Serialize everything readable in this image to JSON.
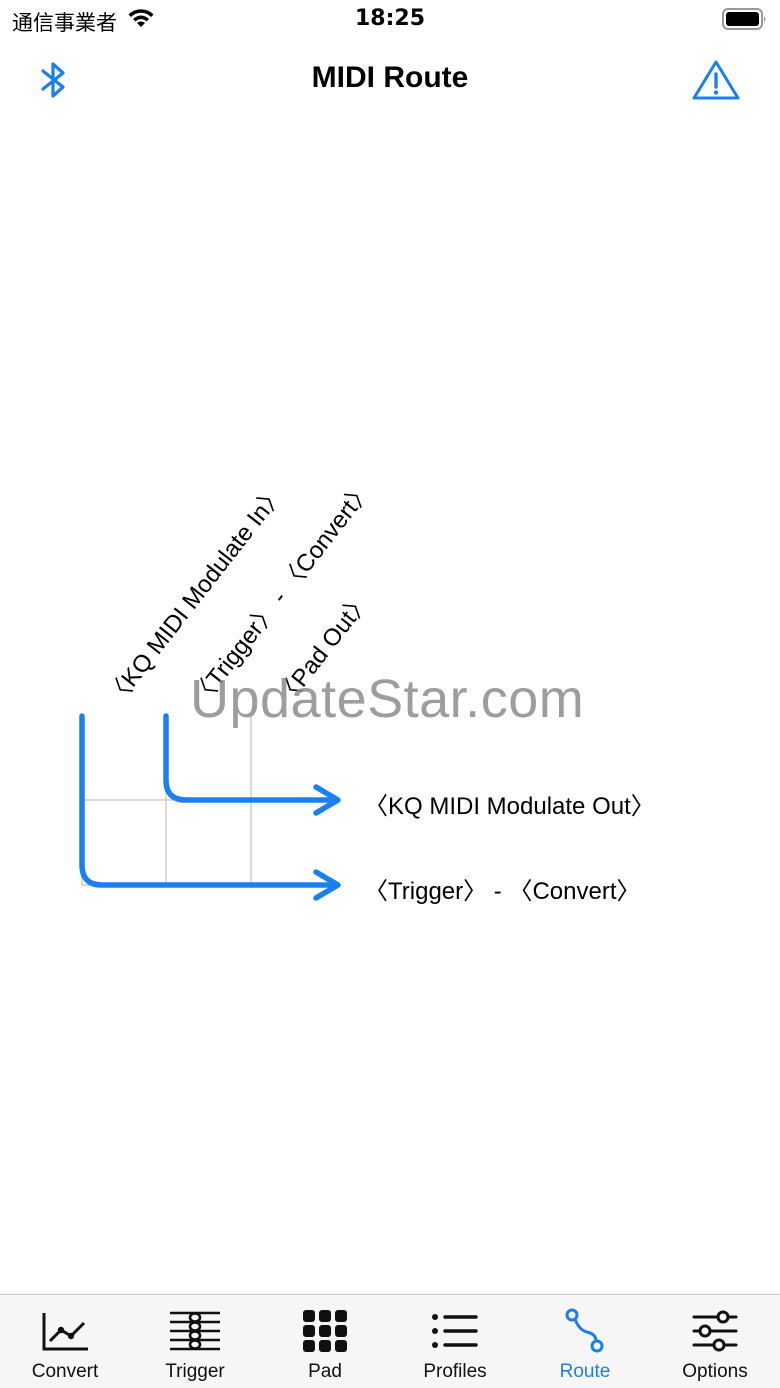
{
  "status_bar": {
    "carrier": "通信事業者",
    "time": "18:25"
  },
  "nav": {
    "title": "MIDI Route",
    "left_icon": "bluetooth-icon",
    "right_icon": "warning-icon"
  },
  "route": {
    "sources": [
      "〈KQ MIDI Modulate In〉",
      "〈Trigger〉 - 〈Convert〉",
      "〈Pad Out〉"
    ],
    "destinations": [
      "〈KQ MIDI Modulate Out〉",
      "〈Trigger〉 - 〈Convert〉"
    ]
  },
  "watermark": "UpdateStar.com",
  "tabs": [
    {
      "label": "Convert",
      "icon": "chart-line-icon"
    },
    {
      "label": "Trigger",
      "icon": "staff-notes-icon"
    },
    {
      "label": "Pad",
      "icon": "grid-pad-icon"
    },
    {
      "label": "Profiles",
      "icon": "list-icon"
    },
    {
      "label": "Route",
      "icon": "route-icon"
    },
    {
      "label": "Options",
      "icon": "sliders-icon"
    }
  ],
  "colors": {
    "accent": "#1a80f0",
    "grid": "#cfcfcf",
    "tab_bar_bg": "#f6f6f7"
  }
}
